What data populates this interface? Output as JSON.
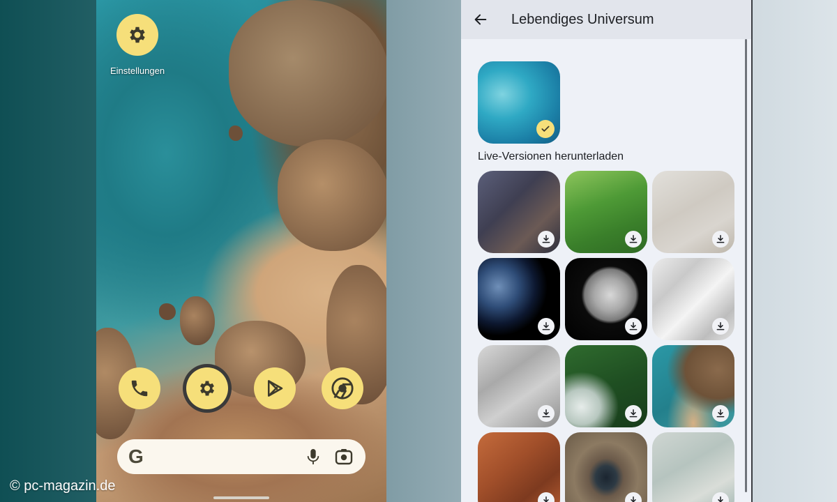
{
  "home": {
    "settings_app_label": "Einstellungen",
    "dock": {
      "phone_icon": "phone-icon",
      "settings_icon": "gear-icon",
      "play_store_icon": "play-store-icon",
      "chrome_icon": "chrome-icon"
    },
    "search": {
      "logo_letter": "G",
      "mic_icon": "mic-icon",
      "lens_icon": "camera-icon"
    }
  },
  "picker": {
    "title": "Lebendiges Universum",
    "back_icon": "arrow-left-icon",
    "selected_wallpaper": {
      "name": "ocean-reef",
      "state": "selected"
    },
    "section_label": "Live-Versionen herunterladen",
    "wallpapers": [
      {
        "name": "canyon-rocks",
        "state": "download"
      },
      {
        "name": "green-meadow",
        "state": "download"
      },
      {
        "name": "white-sand",
        "state": "download"
      },
      {
        "name": "earth",
        "state": "download"
      },
      {
        "name": "moon",
        "state": "download"
      },
      {
        "name": "city-tower",
        "state": "download"
      },
      {
        "name": "city-blocks",
        "state": "download"
      },
      {
        "name": "rainforest",
        "state": "download"
      },
      {
        "name": "coast-beach",
        "state": "download"
      },
      {
        "name": "red-desert",
        "state": "download"
      },
      {
        "name": "volcano-crater",
        "state": "download"
      },
      {
        "name": "pale-shore",
        "state": "download"
      }
    ]
  },
  "colors": {
    "accent_yellow": "#f6df7a",
    "picker_bg": "#eef1f7",
    "header_bg": "#e2e5ec"
  },
  "watermark": "© pc-magazin.de"
}
